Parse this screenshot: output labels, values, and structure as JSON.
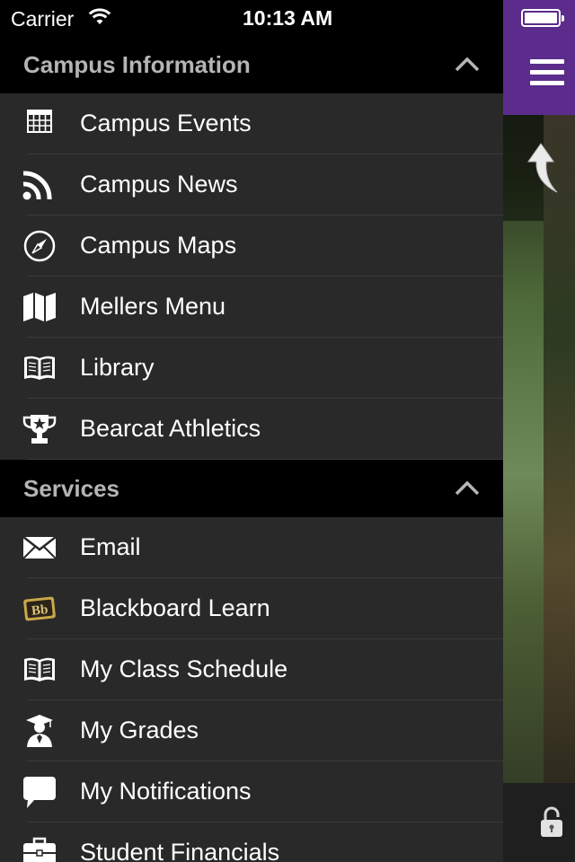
{
  "status_bar": {
    "carrier": "Carrier",
    "time": "10:13 AM"
  },
  "sections": [
    {
      "title": "Campus Information",
      "items": [
        {
          "label": "Campus Events",
          "icon": "calendar-icon"
        },
        {
          "label": "Campus News",
          "icon": "rss-icon"
        },
        {
          "label": "Campus Maps",
          "icon": "compass-icon"
        },
        {
          "label": "Mellers Menu",
          "icon": "map-icon"
        },
        {
          "label": "Library",
          "icon": "book-icon"
        },
        {
          "label": "Bearcat Athletics",
          "icon": "trophy-icon"
        }
      ]
    },
    {
      "title": "Services",
      "items": [
        {
          "label": "Email",
          "icon": "envelope-icon"
        },
        {
          "label": "Blackboard Learn",
          "icon": "blackboard-icon",
          "icon_text": "Bb"
        },
        {
          "label": "My Class Schedule",
          "icon": "book-icon"
        },
        {
          "label": "My Grades",
          "icon": "graduate-icon"
        },
        {
          "label": "My Notifications",
          "icon": "speech-bubble-icon"
        },
        {
          "label": "Student Financials",
          "icon": "briefcase-icon"
        }
      ]
    }
  ],
  "colors": {
    "menu_bg": "#292929",
    "section_header_bg": "#000000",
    "section_header_text": "#b4b4b4",
    "accent_purple": "#5b2c8c"
  }
}
